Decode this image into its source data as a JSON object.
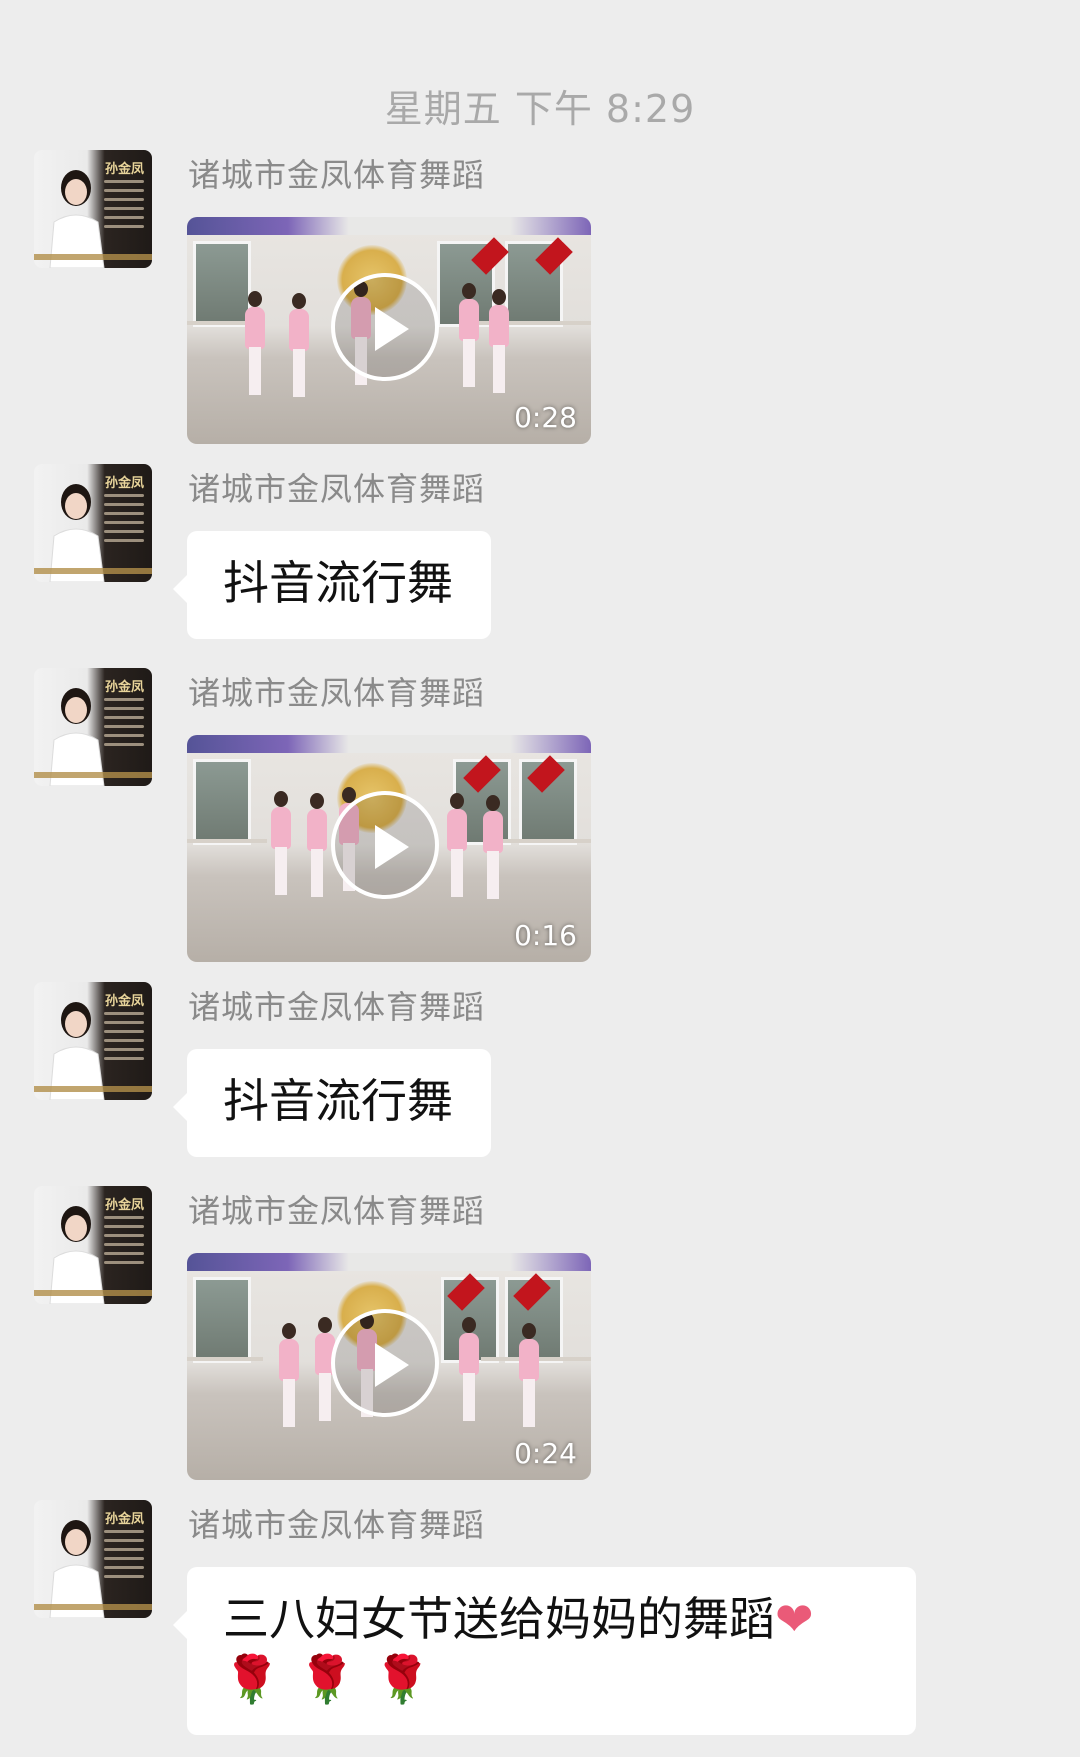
{
  "timestamp": "星期五 下午 8:29",
  "messages": [
    {
      "type": "video",
      "sender": "诸城市金凤体育舞蹈",
      "duration": "0:28",
      "avatar_icon": "profile-photo"
    },
    {
      "type": "text",
      "sender": "诸城市金凤体育舞蹈",
      "text": "抖音流行舞",
      "avatar_icon": "profile-photo"
    },
    {
      "type": "video",
      "sender": "诸城市金凤体育舞蹈",
      "duration": "0:16",
      "avatar_icon": "profile-photo"
    },
    {
      "type": "text",
      "sender": "诸城市金凤体育舞蹈",
      "text": "抖音流行舞",
      "avatar_icon": "profile-photo"
    },
    {
      "type": "video",
      "sender": "诸城市金凤体育舞蹈",
      "duration": "0:24",
      "avatar_icon": "profile-photo"
    },
    {
      "type": "text",
      "sender": "诸城市金凤体育舞蹈",
      "text": "三八妇女节送给妈妈的舞蹈",
      "emoji_line1": "❤",
      "emoji_line2": "🌹🌹🌹",
      "avatar_icon": "profile-photo"
    }
  ],
  "avatar_name_tag": "孙金凤",
  "colors": {
    "background": "#ededed",
    "bubble": "#ffffff",
    "sender_text": "#8a8a8a",
    "timestamp_text": "#a9a9a9"
  }
}
